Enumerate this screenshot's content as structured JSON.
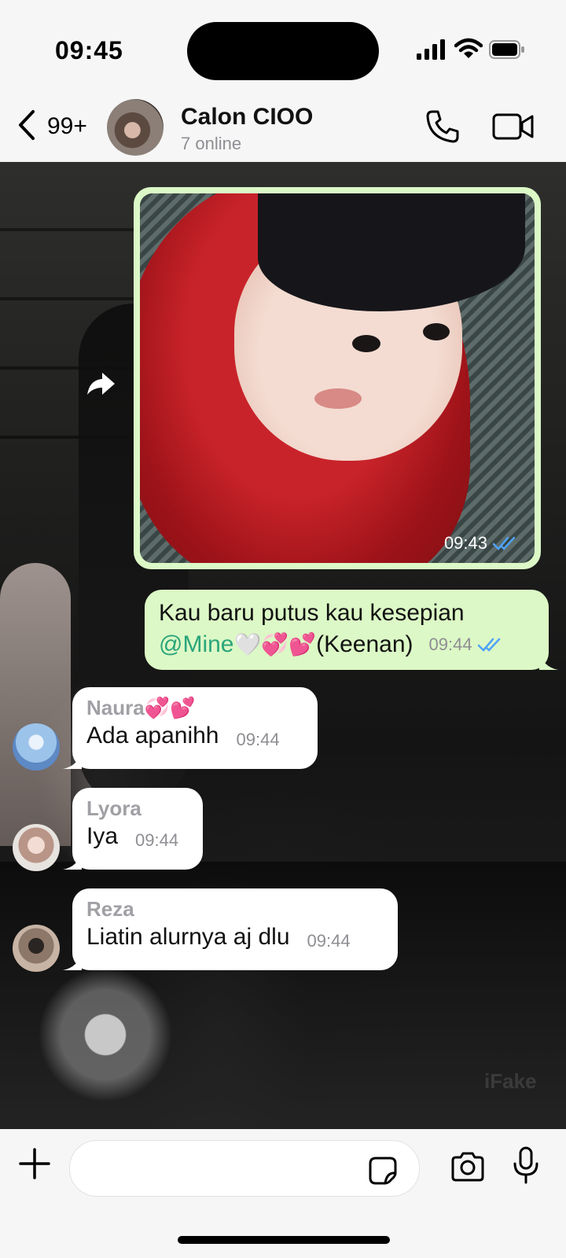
{
  "status_bar": {
    "time": "09:45"
  },
  "header": {
    "back_count": "99+",
    "group_name": "Calon CIOO",
    "subtitle": "7 online"
  },
  "messages": [
    {
      "type": "image",
      "direction": "out",
      "time": "09:43",
      "ticks": "read"
    },
    {
      "type": "text",
      "direction": "out",
      "line1": "Kau baru putus kau kesepian",
      "mention": "@Mine",
      "emoji": "🤍💞💕",
      "suffix": "(Keenan)",
      "time": "09:44",
      "ticks": "read"
    },
    {
      "type": "text",
      "direction": "in",
      "sender": "Naura",
      "sender_emoji": "💞💕",
      "text": "Ada apanihh",
      "time": "09:44"
    },
    {
      "type": "text",
      "direction": "in",
      "sender": "Lyora",
      "text": "Iya",
      "time": "09:44"
    },
    {
      "type": "text",
      "direction": "in",
      "sender": "Reza",
      "text": "Liatin alurnya aj dlu",
      "time": "09:44"
    }
  ],
  "watermark": "iFake",
  "colors": {
    "outgoing_bubble": "#dcf8c6",
    "incoming_bubble": "#ffffff",
    "mention": "#2aa57a",
    "read_ticks": "#4fa3f7"
  }
}
